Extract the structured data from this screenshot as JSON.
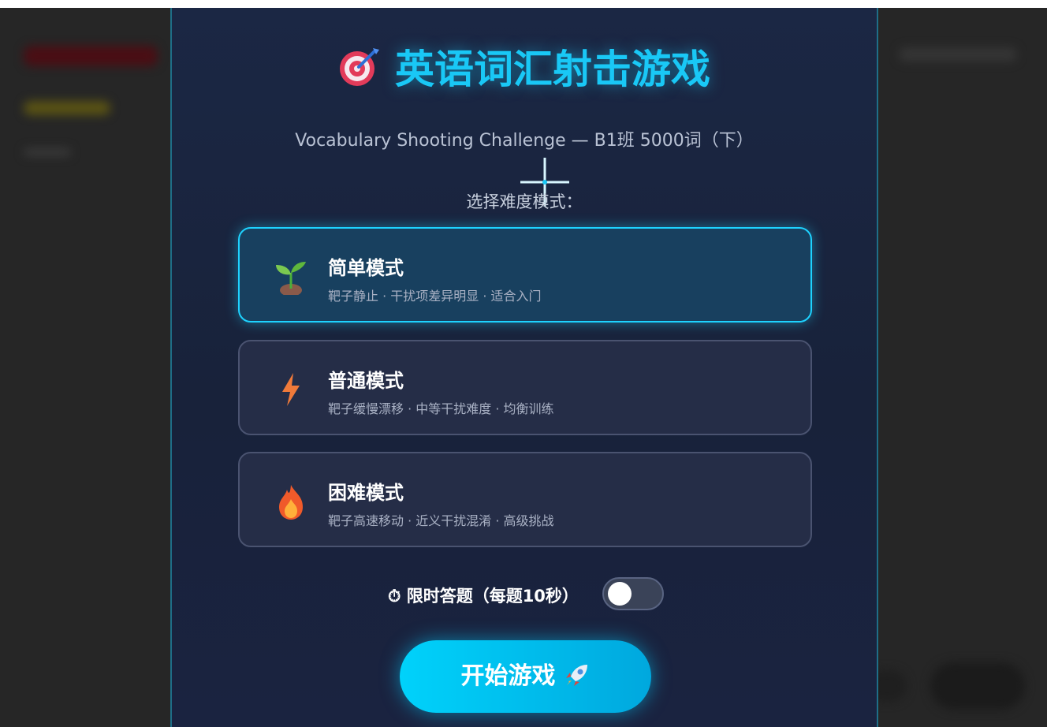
{
  "page": {
    "title": "英语词汇射击游戏",
    "subtitle": "Vocabulary Shooting Challenge — B1班 5000词（下）",
    "difficulty_prompt": "选择难度模式："
  },
  "modes": [
    {
      "name": "简单模式",
      "description": "靶子静止 · 干扰项差异明显 · 适合入门",
      "icon": "seedling-icon",
      "selected": true
    },
    {
      "name": "普通模式",
      "description": "靶子缓慢漂移 · 中等干扰难度 · 均衡训练",
      "icon": "lightning-icon",
      "selected": false
    },
    {
      "name": "困难模式",
      "description": "靶子高速移动 · 近义干扰混淆 · 高级挑战",
      "icon": "fire-icon",
      "selected": false
    }
  ],
  "timer": {
    "label": "⏱ 限时答题（每题10秒）",
    "enabled": false
  },
  "start_button": {
    "label": "开始游戏"
  },
  "colors": {
    "accent": "#19c8f6",
    "selected_border": "#1ed2ff",
    "panel_bg": "#1b2744",
    "button": "#00c4f2"
  }
}
